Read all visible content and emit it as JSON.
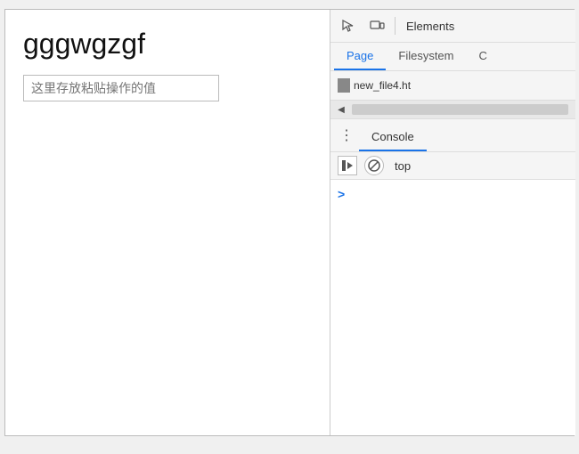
{
  "left": {
    "title": "gggwgzgf",
    "input_placeholder": "这里存放粘贴操作的值",
    "input_value": ""
  },
  "devtools": {
    "toolbar": {
      "inspect_icon": "⬚",
      "device_icon": "⬚",
      "elements_label": "Elements"
    },
    "tabs": [
      {
        "label": "Page",
        "active": true
      },
      {
        "label": "Filesystem",
        "active": false
      },
      {
        "label": "C",
        "active": false
      }
    ],
    "file": {
      "name": "new_file4.ht"
    },
    "console_section": {
      "tab_label": "Console"
    },
    "console_toolbar": {
      "top_label": "top"
    },
    "console_prompt": ">"
  }
}
